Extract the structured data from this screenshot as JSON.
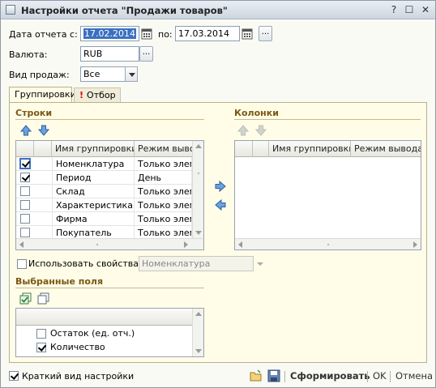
{
  "window": {
    "title": "Настройки отчета \"Продажи товаров\"",
    "help_label": "?",
    "maximize_label": "☐",
    "close_label": "✕"
  },
  "form": {
    "date_from_label": "Дата отчета с:",
    "date_from_value": "17.02.2014",
    "date_to_label": "по:",
    "date_to_value": "17.03.2014",
    "period_button_label": "...",
    "currency_label": "Валюта:",
    "currency_value": "RUB",
    "currency_button_label": "...",
    "sales_type_label": "Вид продаж:",
    "sales_type_value": "Все"
  },
  "tabs": [
    {
      "label": "Группировки",
      "active": true
    },
    {
      "label": "Отбор",
      "active": false,
      "marker": "!"
    }
  ],
  "rows_section": {
    "title": "Строки",
    "columns": [
      "Имя группировки",
      "Режим вывод"
    ],
    "items": [
      {
        "checked": true,
        "name": "Номенклатура",
        "mode": "Только элем"
      },
      {
        "checked": true,
        "name": "Период",
        "mode": "День"
      },
      {
        "checked": false,
        "name": "Склад",
        "mode": "Только элем"
      },
      {
        "checked": false,
        "name": "Характеристика...",
        "mode": "Только элем"
      },
      {
        "checked": false,
        "name": "Фирма",
        "mode": "Только элем"
      },
      {
        "checked": false,
        "name": "Покупатель",
        "mode": "Только элем"
      }
    ]
  },
  "columns_section": {
    "title": "Колонки",
    "columns": [
      "Имя группировки",
      "Режим вывода"
    ],
    "items": []
  },
  "use_properties": {
    "label": "Использовать свойства",
    "checked": false,
    "value": "Номенклатура"
  },
  "selected_fields": {
    "title": "Выбранные поля",
    "items": [
      {
        "checked": false,
        "label": "Остаток (ед. отч.)"
      },
      {
        "checked": true,
        "label": "Количество"
      }
    ]
  },
  "footer": {
    "brief_label": "Краткий вид настройки",
    "brief_checked": true,
    "generate_label": "Сформировать",
    "ok_label": "OK",
    "cancel_label": "Отмена"
  },
  "colors": {
    "section_title": "#7b5712",
    "panel_bg": "#fffde8",
    "selection": "#3a70c0"
  }
}
